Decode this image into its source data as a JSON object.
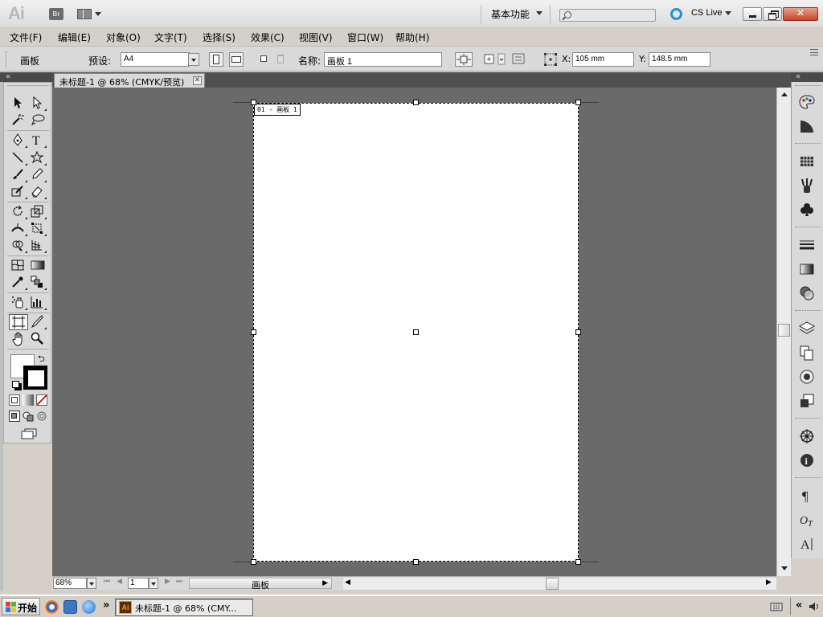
{
  "app": {
    "logo": "Ai",
    "bridge": "Br",
    "workspace": "基本功能",
    "cs_live": "CS Live"
  },
  "menu": [
    "文件(F)",
    "编辑(E)",
    "对象(O)",
    "文字(T)",
    "选择(S)",
    "效果(C)",
    "视图(V)",
    "窗口(W)",
    "帮助(H)"
  ],
  "control_bar": {
    "mode_label": "画板",
    "preset_label": "预设:",
    "preset_value": "A4",
    "name_label": "名称:",
    "name_value": "画板 1",
    "x_label": "X:",
    "x_value": "105 mm",
    "y_label": "Y:",
    "y_value": "148.5 mm"
  },
  "document": {
    "tab_title": "未标题-1 @ 68% (CMYK/预览)",
    "artboard_label": "01 - 画板 1"
  },
  "status": {
    "zoom": "68%",
    "page": "1",
    "status_text": "画板"
  },
  "taskbar": {
    "start": "开始",
    "task_title": "未标题-1 @ 68% (CMY...",
    "more": "»",
    "collapse": "«"
  },
  "colors": {
    "canvas": "#6a6a6a",
    "panel": "#d9d9d9",
    "artboard": "#ffffff",
    "close_button": "#c8462a",
    "cs_live_accent": "#2a8fd0"
  }
}
